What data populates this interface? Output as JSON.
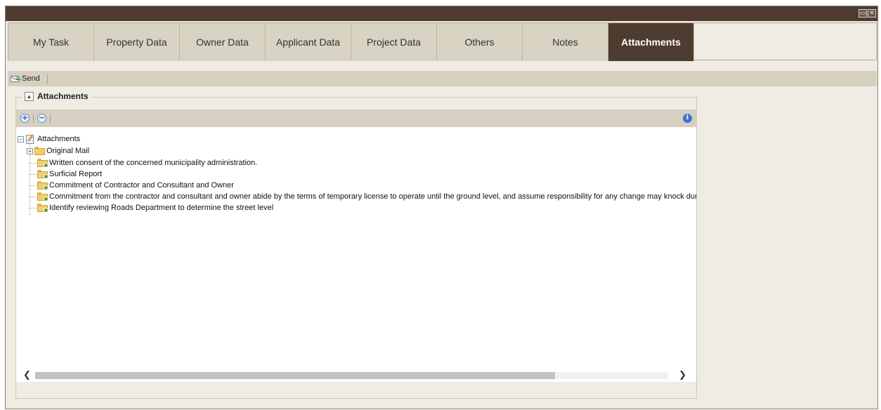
{
  "window": {
    "maximize_icon": "maximize-icon",
    "close_icon": "close-icon"
  },
  "tabs": [
    {
      "label": "My Task",
      "active": false
    },
    {
      "label": "Property Data",
      "active": false
    },
    {
      "label": "Owner Data",
      "active": false
    },
    {
      "label": "Applicant Data",
      "active": false
    },
    {
      "label": "Project Data",
      "active": false
    },
    {
      "label": "Others",
      "active": false
    },
    {
      "label": "Notes",
      "active": false
    },
    {
      "label": "Attachments",
      "active": true
    }
  ],
  "toolbar": {
    "send_label": "Send",
    "send_icon": "send-mail-icon"
  },
  "panel": {
    "title": "Attachments",
    "tree_toolbar": {
      "add_icon": "add-icon",
      "remove_icon": "remove-icon",
      "info_icon": "info-icon"
    },
    "tree": {
      "root": {
        "label": "Attachments",
        "expanded": true
      },
      "children": [
        {
          "label": "Original Mail",
          "expandable": true
        },
        {
          "label": "Written consent of the concerned municipality administration."
        },
        {
          "label": "Surficial Report"
        },
        {
          "label": "Commitment of Contractor and Consultant and Owner"
        },
        {
          "label": "Commitment from the contractor and consultant and owner abide by the terms of temporary license to operate until the ground level, and assume responsibility for any change may knock during th"
        },
        {
          "label": "Identify reviewing Roads Department to determine the street level"
        }
      ]
    }
  },
  "colors": {
    "header_dark": "#4e3c30",
    "tab_bg": "#d9d3c3",
    "panel_bg": "#efece3"
  }
}
